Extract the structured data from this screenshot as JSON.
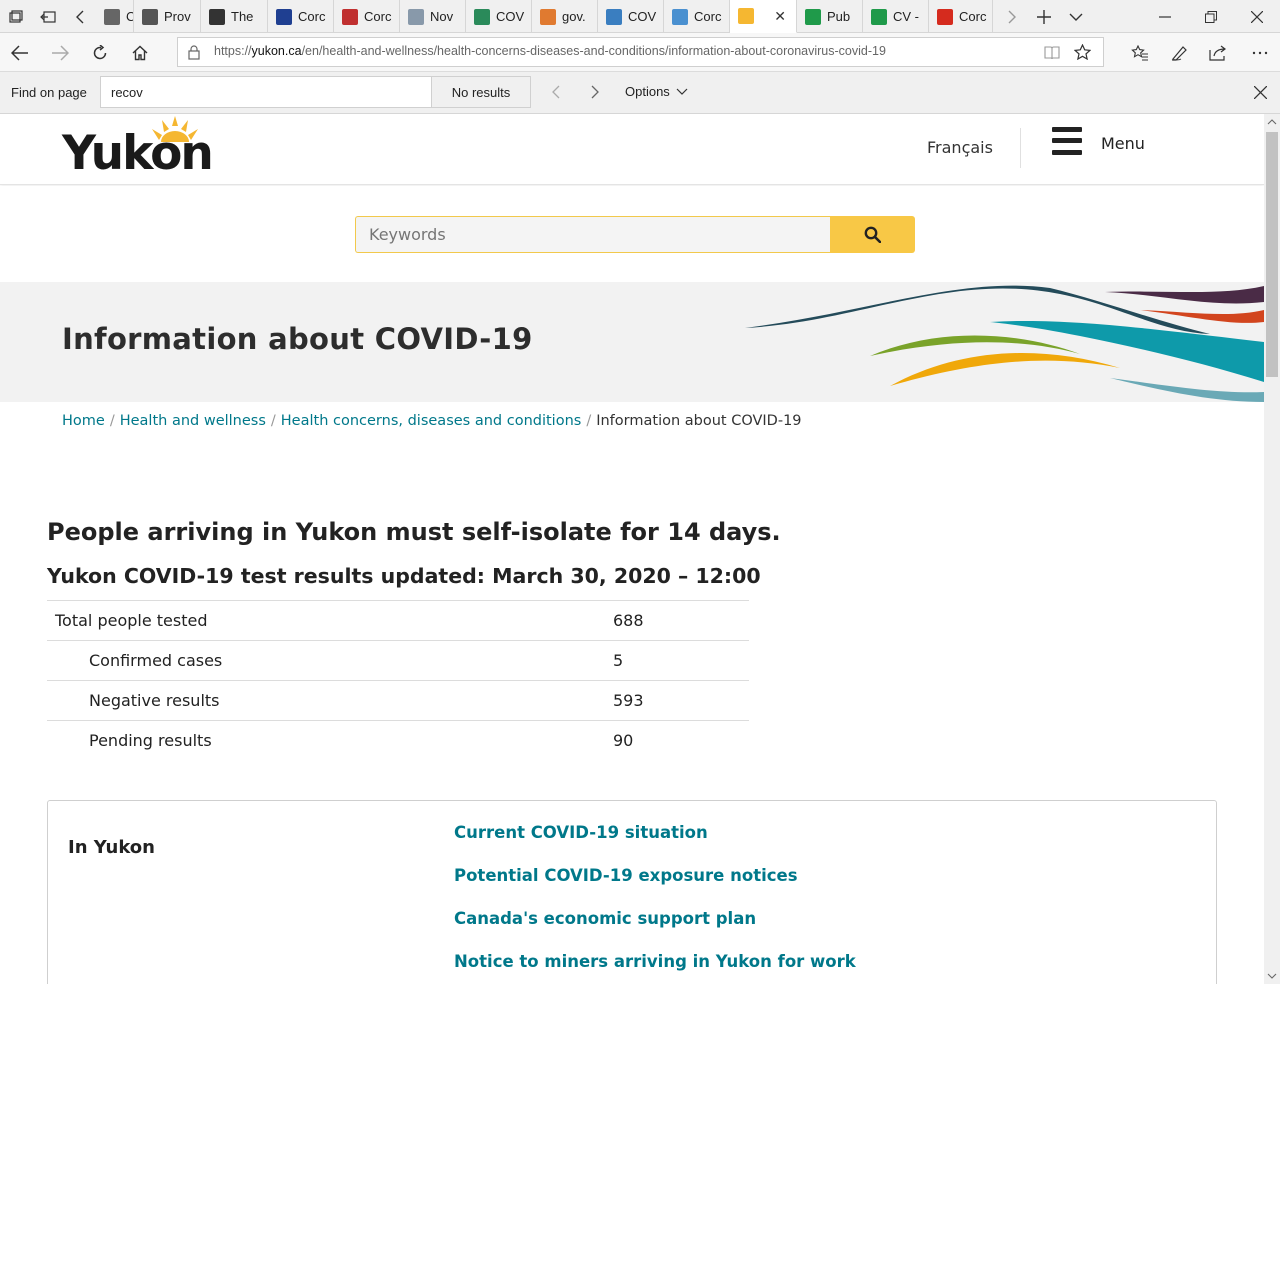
{
  "browser": {
    "tabs": [
      {
        "label": "Case",
        "fav_color": "#666666"
      },
      {
        "label": "Prov",
        "fav_color": "#555555"
      },
      {
        "label": "The",
        "fav_color": "#333333"
      },
      {
        "label": "Corc",
        "fav_color": "#1f3f91"
      },
      {
        "label": "Corc",
        "fav_color": "#c03030"
      },
      {
        "label": "Nov",
        "fav_color": "#8899aa"
      },
      {
        "label": "COV",
        "fav_color": "#2a8a5a"
      },
      {
        "label": "gov.",
        "fav_color": "#e07a30"
      },
      {
        "label": "COV",
        "fav_color": "#3a7ec0"
      },
      {
        "label": "Corc",
        "fav_color": "#4a90d0"
      },
      {
        "label": "",
        "fav_color": "#f5b731",
        "active": true
      },
      {
        "label": "Pub",
        "fav_color": "#1f9a4a"
      },
      {
        "label": "CV -",
        "fav_color": "#1f9a4a"
      },
      {
        "label": "Corc",
        "fav_color": "#d52b1e"
      }
    ],
    "url_prefix": "https://",
    "url_host": "yukon.ca",
    "url_path": "/en/health-and-wellness/health-concerns-diseases-and-conditions/information-about-coronavirus-covid-19",
    "find": {
      "label": "Find on page",
      "query": "recov",
      "status": "No results",
      "options_label": "Options"
    }
  },
  "site": {
    "logo_text": "Yukon",
    "lang_link": "Français",
    "menu_label": "Menu",
    "search_placeholder": "Keywords",
    "accent_color": "#f8c846",
    "link_color": "#00788a"
  },
  "hero": {
    "title": "Information about COVID-19"
  },
  "breadcrumb": [
    {
      "label": "Home",
      "link": true
    },
    {
      "label": "Health and wellness",
      "link": true
    },
    {
      "label": "Health concerns, diseases and conditions",
      "link": true
    },
    {
      "label": "Information about COVID-19",
      "link": false
    }
  ],
  "main": {
    "notice": "People arriving in Yukon must self-isolate for 14 days.",
    "results_title": "Yukon COVID-19 test results updated: March 30, 2020 – 12:00",
    "results": [
      {
        "label": "Total people tested",
        "value": "688"
      },
      {
        "label": "Confirmed cases",
        "value": "5"
      },
      {
        "label": "Negative results",
        "value": "593"
      },
      {
        "label": "Pending results",
        "value": "90"
      }
    ]
  },
  "links_box": {
    "heading": "In Yukon",
    "links": [
      "Current COVID-19 situation",
      "Potential COVID-19 exposure notices",
      "Canada's economic support plan",
      "Notice to miners arriving in Yukon for work"
    ]
  }
}
